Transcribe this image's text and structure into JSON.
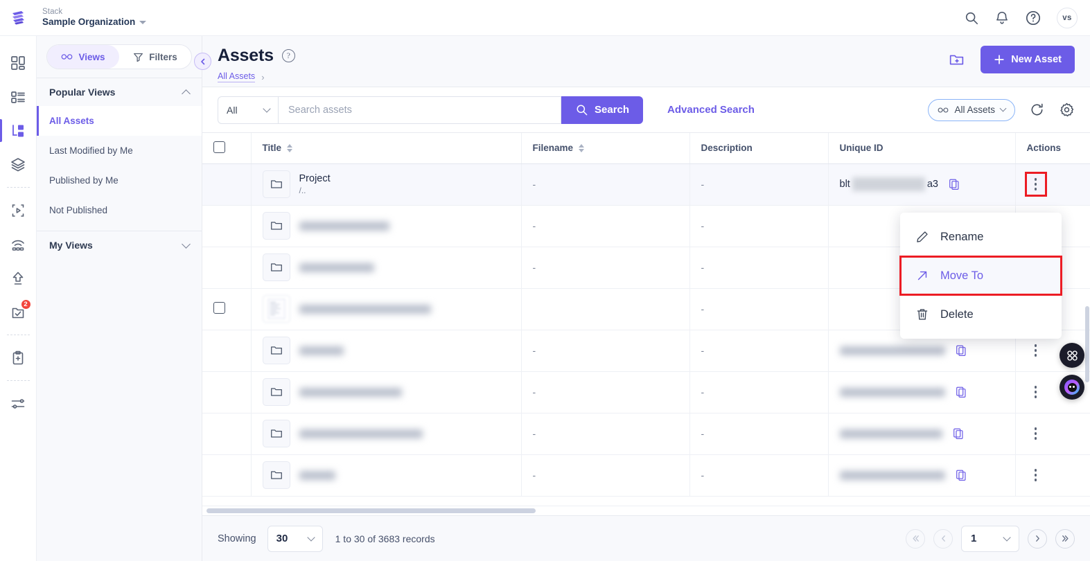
{
  "topbar": {
    "org_label": "Stack",
    "org_name": "Sample Organization",
    "icons": {
      "search": "search-icon",
      "bell": "notification-bell-icon",
      "help": "help-circle-icon"
    },
    "avatar_initials": "vs"
  },
  "rail": {
    "items": [
      {
        "name": "dashboard-icon",
        "badge": ""
      },
      {
        "name": "content-types-icon",
        "badge": ""
      },
      {
        "name": "entries-icon",
        "badge": "",
        "active": true
      },
      {
        "name": "assets-stack-icon",
        "badge": ""
      },
      {
        "name": "live-preview-icon",
        "badge": ""
      },
      {
        "name": "releases-icon",
        "badge": ""
      },
      {
        "name": "publish-queue-icon",
        "badge": ""
      },
      {
        "name": "tasks-icon",
        "badge": "2"
      },
      {
        "name": "audit-log-icon",
        "badge": ""
      },
      {
        "name": "settings-sliders-icon",
        "badge": ""
      }
    ]
  },
  "views_panel": {
    "segment": {
      "views_label": "Views",
      "filters_label": "Filters",
      "active": "Views"
    },
    "popular_views": {
      "title": "Popular Views",
      "expanded": true,
      "items": [
        {
          "label": "All Assets",
          "active": true
        },
        {
          "label": "Last Modified by Me",
          "active": false
        },
        {
          "label": "Published by Me",
          "active": false
        },
        {
          "label": "Not Published",
          "active": false
        }
      ]
    },
    "my_views": {
      "title": "My Views",
      "expanded": false
    }
  },
  "page": {
    "title": "Assets",
    "breadcrumb": [
      "All Assets"
    ],
    "new_asset_label": "New Asset",
    "new_folder_icon": "new-folder-icon"
  },
  "toolbar": {
    "scope_value": "All",
    "search_placeholder": "Search assets",
    "search_value": "",
    "search_button_label": "Search",
    "advanced_search_label": "Advanced Search",
    "view_chip_label": "All Assets",
    "refresh_icon": "refresh-icon",
    "settings_icon": "gear-icon"
  },
  "table": {
    "columns": [
      {
        "label": "",
        "key": "checkbox"
      },
      {
        "label": "Title",
        "key": "title",
        "sortable": true
      },
      {
        "label": "Filename",
        "key": "filename",
        "sortable": true
      },
      {
        "label": "Description",
        "key": "description",
        "sortable": false
      },
      {
        "label": "Unique ID",
        "key": "unique_id",
        "sortable": false
      },
      {
        "label": "Actions",
        "key": "actions",
        "sortable": false
      }
    ],
    "rows": [
      {
        "icon": "folder-icon",
        "title": "Project",
        "subtitle": "/..",
        "filename": "-",
        "description": "-",
        "unique_id_prefix": "blt",
        "unique_id_suffix": "a3",
        "redacted": true,
        "copy_icon": true,
        "checkbox": false,
        "highlight": true,
        "blurred": false
      },
      {
        "icon": "folder-icon",
        "title": "",
        "subtitle": "",
        "filename": "-",
        "description": "-",
        "unique_id_prefix": "",
        "unique_id_suffix": "",
        "redacted": true,
        "copy_icon": false,
        "checkbox": false,
        "highlight": false,
        "blurred": true,
        "blur_width": 130
      },
      {
        "icon": "folder-icon",
        "title": "",
        "subtitle": "",
        "filename": "-",
        "description": "-",
        "unique_id_prefix": "",
        "unique_id_suffix": "",
        "redacted": true,
        "copy_icon": false,
        "checkbox": false,
        "highlight": false,
        "blurred": true,
        "blur_width": 108
      },
      {
        "icon": "document-thumb-icon",
        "title": "",
        "subtitle": "",
        "filename": "",
        "description": "-",
        "unique_id_prefix": "",
        "unique_id_suffix": "",
        "redacted": true,
        "copy_icon": false,
        "checkbox": true,
        "highlight": false,
        "blurred": true,
        "blur_width": 190
      },
      {
        "icon": "folder-icon",
        "title": "",
        "subtitle": "",
        "filename": "-",
        "description": "-",
        "unique_id_prefix": "",
        "unique_id_suffix": "",
        "redacted": true,
        "copy_icon": true,
        "checkbox": false,
        "highlight": false,
        "blurred": true,
        "blur_width": 64
      },
      {
        "icon": "folder-icon",
        "title": "",
        "subtitle": "",
        "filename": "-",
        "description": "-",
        "unique_id_prefix": "",
        "unique_id_suffix": "",
        "redacted": true,
        "copy_icon": true,
        "checkbox": false,
        "highlight": false,
        "blurred": true,
        "blur_width": 148
      },
      {
        "icon": "folder-icon",
        "title": "",
        "subtitle": "",
        "filename": "-",
        "description": "-",
        "unique_id_prefix": "",
        "unique_id_suffix": "",
        "redacted": true,
        "copy_icon": true,
        "checkbox": false,
        "highlight": false,
        "blurred": true,
        "blur_width": 178
      },
      {
        "icon": "folder-icon",
        "title": "",
        "subtitle": "",
        "filename": "-",
        "description": "-",
        "unique_id_prefix": "",
        "unique_id_suffix": "",
        "redacted": true,
        "copy_icon": true,
        "checkbox": false,
        "highlight": false,
        "blurred": true,
        "blur_width": 52
      }
    ]
  },
  "context_menu": {
    "items": [
      {
        "label": "Rename",
        "icon": "pencil-icon",
        "selected": false
      },
      {
        "label": "Move To",
        "icon": "arrow-up-right-icon",
        "selected": true
      },
      {
        "label": "Delete",
        "icon": "trash-icon",
        "selected": false
      }
    ]
  },
  "footer": {
    "showing_label": "Showing",
    "page_size": "30",
    "records_label": "1 to 30 of 3683 records",
    "current_page": "1",
    "first_icon": "double-chevron-left-icon",
    "prev_icon": "chevron-left-icon",
    "next_icon": "chevron-right-icon",
    "last_icon": "double-chevron-right-icon"
  },
  "fabs": [
    {
      "name": "apps-grid-fab",
      "label": ""
    },
    {
      "name": "assistant-avatar-fab",
      "label": ""
    }
  ],
  "colors": {
    "accent": "#6c5ce7",
    "highlight_outline": "#ec1c24",
    "panel_bg": "#f8f9fc",
    "text_dark": "#212b45"
  }
}
